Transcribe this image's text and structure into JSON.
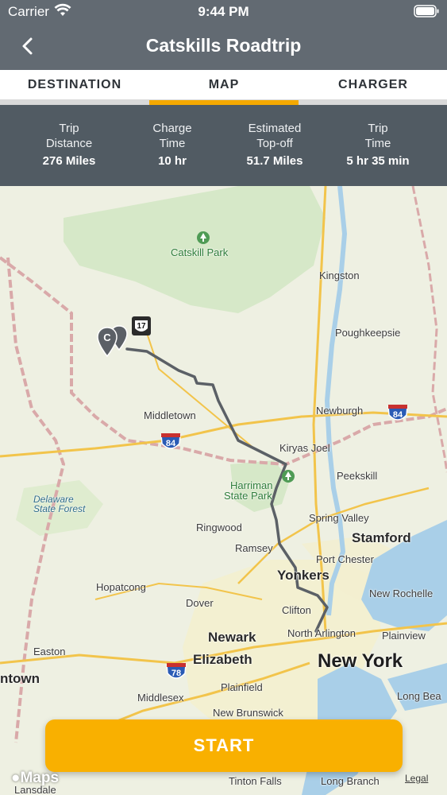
{
  "status_bar": {
    "carrier": "Carrier",
    "time": "9:44 PM"
  },
  "nav": {
    "title": "Catskills Roadtrip"
  },
  "tabs": [
    {
      "label": "DESTINATION",
      "selected": false
    },
    {
      "label": "MAP",
      "selected": true
    },
    {
      "label": "CHARGER",
      "selected": false
    }
  ],
  "stats": [
    {
      "label_line1": "Trip",
      "label_line2": "Distance",
      "value": "276 Miles"
    },
    {
      "label_line1": "Charge",
      "label_line2": "Time",
      "value": "10 hr"
    },
    {
      "label_line1": "Estimated",
      "label_line2": "Top-off",
      "value": "51.7 Miles"
    },
    {
      "label_line1": "Trip",
      "label_line2": "Time",
      "value": "5 hr 35 min"
    }
  ],
  "map": {
    "labels": {
      "catskill_park": "Catskill Park",
      "kingston": "Kingston",
      "poughkeepsie": "Poughkeepsie",
      "newburgh": "Newburgh",
      "middletown": "Middletown",
      "kiryas_joel": "Kiryas Joel",
      "peekskill": "Peekskill",
      "harriman_line1": "Harriman",
      "harriman_line2": "State Park",
      "spring_valley": "Spring Valley",
      "ringwood": "Ringwood",
      "stamford": "Stamford",
      "ramsey": "Ramsey",
      "port_chester": "Port Chester",
      "yonkers": "Yonkers",
      "new_rochelle": "New Rochelle",
      "hopatcong": "Hopatcong",
      "dover": "Dover",
      "clifton": "Clifton",
      "north_arlington": "North Arlington",
      "plainview": "Plainview",
      "newark": "Newark",
      "easton": "Easton",
      "elizabeth": "Elizabeth",
      "new_york": "New York",
      "ntown": "ntown",
      "plainfield": "Plainfield",
      "middlesex": "Middlesex",
      "long_beach": "Long Bea",
      "new_brunswick": "New Brunswick",
      "delaware_line1": "Delaware",
      "delaware_line2": "State Forest",
      "tinton_falls": "Tinton Falls",
      "long_branch": "Long Branch",
      "lansdale": "Lansdale"
    },
    "shields": {
      "route17": "17",
      "i84_east": "84",
      "i84_west": "84",
      "i78": "78"
    },
    "pin_letter": "C"
  },
  "start_button": {
    "label": "START"
  },
  "maps_brand": "Maps",
  "legal": "Legal",
  "colors": {
    "accent": "#f9b000",
    "nav_bg": "#626a72",
    "stats_bg": "#515b63"
  }
}
